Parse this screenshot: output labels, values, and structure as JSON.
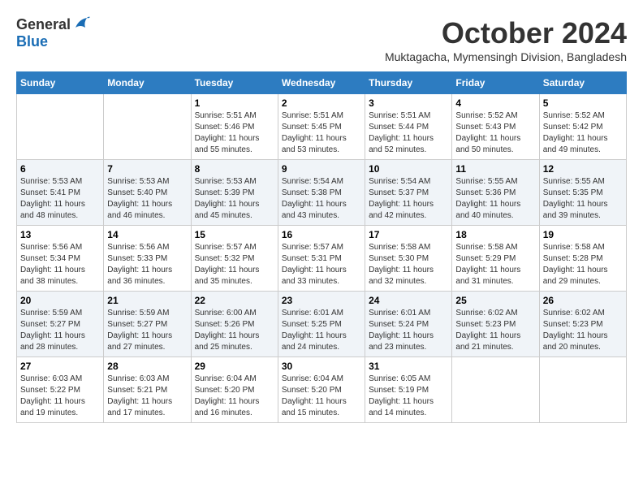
{
  "header": {
    "logo_general": "General",
    "logo_blue": "Blue",
    "month": "October 2024",
    "location": "Muktagacha, Mymensingh Division, Bangladesh"
  },
  "days_of_week": [
    "Sunday",
    "Monday",
    "Tuesday",
    "Wednesday",
    "Thursday",
    "Friday",
    "Saturday"
  ],
  "weeks": [
    [
      {
        "day": "",
        "info": ""
      },
      {
        "day": "",
        "info": ""
      },
      {
        "day": "1",
        "info": "Sunrise: 5:51 AM\nSunset: 5:46 PM\nDaylight: 11 hours and 55 minutes."
      },
      {
        "day": "2",
        "info": "Sunrise: 5:51 AM\nSunset: 5:45 PM\nDaylight: 11 hours and 53 minutes."
      },
      {
        "day": "3",
        "info": "Sunrise: 5:51 AM\nSunset: 5:44 PM\nDaylight: 11 hours and 52 minutes."
      },
      {
        "day": "4",
        "info": "Sunrise: 5:52 AM\nSunset: 5:43 PM\nDaylight: 11 hours and 50 minutes."
      },
      {
        "day": "5",
        "info": "Sunrise: 5:52 AM\nSunset: 5:42 PM\nDaylight: 11 hours and 49 minutes."
      }
    ],
    [
      {
        "day": "6",
        "info": "Sunrise: 5:53 AM\nSunset: 5:41 PM\nDaylight: 11 hours and 48 minutes."
      },
      {
        "day": "7",
        "info": "Sunrise: 5:53 AM\nSunset: 5:40 PM\nDaylight: 11 hours and 46 minutes."
      },
      {
        "day": "8",
        "info": "Sunrise: 5:53 AM\nSunset: 5:39 PM\nDaylight: 11 hours and 45 minutes."
      },
      {
        "day": "9",
        "info": "Sunrise: 5:54 AM\nSunset: 5:38 PM\nDaylight: 11 hours and 43 minutes."
      },
      {
        "day": "10",
        "info": "Sunrise: 5:54 AM\nSunset: 5:37 PM\nDaylight: 11 hours and 42 minutes."
      },
      {
        "day": "11",
        "info": "Sunrise: 5:55 AM\nSunset: 5:36 PM\nDaylight: 11 hours and 40 minutes."
      },
      {
        "day": "12",
        "info": "Sunrise: 5:55 AM\nSunset: 5:35 PM\nDaylight: 11 hours and 39 minutes."
      }
    ],
    [
      {
        "day": "13",
        "info": "Sunrise: 5:56 AM\nSunset: 5:34 PM\nDaylight: 11 hours and 38 minutes."
      },
      {
        "day": "14",
        "info": "Sunrise: 5:56 AM\nSunset: 5:33 PM\nDaylight: 11 hours and 36 minutes."
      },
      {
        "day": "15",
        "info": "Sunrise: 5:57 AM\nSunset: 5:32 PM\nDaylight: 11 hours and 35 minutes."
      },
      {
        "day": "16",
        "info": "Sunrise: 5:57 AM\nSunset: 5:31 PM\nDaylight: 11 hours and 33 minutes."
      },
      {
        "day": "17",
        "info": "Sunrise: 5:58 AM\nSunset: 5:30 PM\nDaylight: 11 hours and 32 minutes."
      },
      {
        "day": "18",
        "info": "Sunrise: 5:58 AM\nSunset: 5:29 PM\nDaylight: 11 hours and 31 minutes."
      },
      {
        "day": "19",
        "info": "Sunrise: 5:58 AM\nSunset: 5:28 PM\nDaylight: 11 hours and 29 minutes."
      }
    ],
    [
      {
        "day": "20",
        "info": "Sunrise: 5:59 AM\nSunset: 5:27 PM\nDaylight: 11 hours and 28 minutes."
      },
      {
        "day": "21",
        "info": "Sunrise: 5:59 AM\nSunset: 5:27 PM\nDaylight: 11 hours and 27 minutes."
      },
      {
        "day": "22",
        "info": "Sunrise: 6:00 AM\nSunset: 5:26 PM\nDaylight: 11 hours and 25 minutes."
      },
      {
        "day": "23",
        "info": "Sunrise: 6:01 AM\nSunset: 5:25 PM\nDaylight: 11 hours and 24 minutes."
      },
      {
        "day": "24",
        "info": "Sunrise: 6:01 AM\nSunset: 5:24 PM\nDaylight: 11 hours and 23 minutes."
      },
      {
        "day": "25",
        "info": "Sunrise: 6:02 AM\nSunset: 5:23 PM\nDaylight: 11 hours and 21 minutes."
      },
      {
        "day": "26",
        "info": "Sunrise: 6:02 AM\nSunset: 5:23 PM\nDaylight: 11 hours and 20 minutes."
      }
    ],
    [
      {
        "day": "27",
        "info": "Sunrise: 6:03 AM\nSunset: 5:22 PM\nDaylight: 11 hours and 19 minutes."
      },
      {
        "day": "28",
        "info": "Sunrise: 6:03 AM\nSunset: 5:21 PM\nDaylight: 11 hours and 17 minutes."
      },
      {
        "day": "29",
        "info": "Sunrise: 6:04 AM\nSunset: 5:20 PM\nDaylight: 11 hours and 16 minutes."
      },
      {
        "day": "30",
        "info": "Sunrise: 6:04 AM\nSunset: 5:20 PM\nDaylight: 11 hours and 15 minutes."
      },
      {
        "day": "31",
        "info": "Sunrise: 6:05 AM\nSunset: 5:19 PM\nDaylight: 11 hours and 14 minutes."
      },
      {
        "day": "",
        "info": ""
      },
      {
        "day": "",
        "info": ""
      }
    ]
  ]
}
